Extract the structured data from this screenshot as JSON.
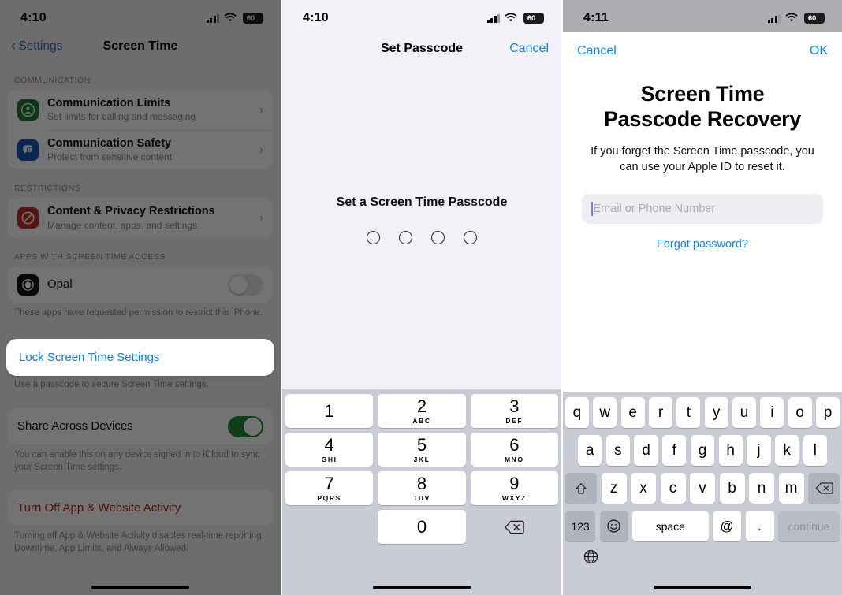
{
  "panel1": {
    "status": {
      "time": "4:10",
      "battery_pct": "60"
    },
    "nav": {
      "back_label": "Settings",
      "title": "Screen Time"
    },
    "groups": [
      {
        "header": "COMMUNICATION",
        "rows": [
          {
            "title": "Communication Limits",
            "subtitle": "Set limits for calling and messaging",
            "icon": "person-circle-icon",
            "accessory": "chevron-right-icon"
          },
          {
            "title": "Communication Safety",
            "subtitle": "Protect from sensitive content",
            "icon": "message-shield-icon",
            "accessory": "chevron-right-icon"
          }
        ]
      },
      {
        "header": "RESTRICTIONS",
        "rows": [
          {
            "title": "Content & Privacy Restrictions",
            "subtitle": "Manage content, apps, and settings",
            "icon": "no-entry-icon",
            "accessory": "chevron-right-icon"
          }
        ]
      },
      {
        "header": "APPS WITH SCREEN TIME ACCESS",
        "rows": [
          {
            "title": "Opal",
            "icon": "opal-app-icon",
            "accessory": "toggle-off"
          }
        ],
        "footnote": "These apps have requested permission to restrict this iPhone."
      }
    ],
    "lock_row": {
      "label": "Lock Screen Time Settings",
      "footnote": "Use a passcode to secure Screen Time settings."
    },
    "share_row": {
      "label": "Share Across Devices",
      "toggle": "on",
      "footnote": "You can enable this on any device signed in to iCloud to sync your Screen Time settings."
    },
    "turn_off_row": {
      "label": "Turn Off App & Website Activity",
      "footnote": "Turning off App & Website Activity disables real-time reporting, Downtime, App Limits, and Always Allowed."
    },
    "colors": {
      "accent": "#0a7bf4",
      "destructive": "#b32a24",
      "toggle_on": "#1d8a35"
    }
  },
  "panel2": {
    "status": {
      "time": "4:10",
      "battery_pct": "60"
    },
    "nav": {
      "title": "Set Passcode",
      "cancel_label": "Cancel"
    },
    "prompt": "Set a Screen Time Passcode",
    "dots_count": 4,
    "dots_filled": 0,
    "numpad": [
      [
        {
          "digit": "1",
          "letters": ""
        },
        {
          "digit": "2",
          "letters": "ABC"
        },
        {
          "digit": "3",
          "letters": "DEF"
        }
      ],
      [
        {
          "digit": "4",
          "letters": "GHI"
        },
        {
          "digit": "5",
          "letters": "JKL"
        },
        {
          "digit": "6",
          "letters": "MNO"
        }
      ],
      [
        {
          "digit": "7",
          "letters": "PQRS"
        },
        {
          "digit": "8",
          "letters": "TUV"
        },
        {
          "digit": "9",
          "letters": "WXYZ"
        }
      ],
      [
        {
          "digit": "",
          "letters": ""
        },
        {
          "digit": "0",
          "letters": ""
        },
        {
          "digit": "delete-icon",
          "letters": ""
        }
      ]
    ]
  },
  "panel3": {
    "status": {
      "time": "4:11",
      "battery_pct": "60"
    },
    "sheet_bar": {
      "cancel_label": "Cancel",
      "ok_label": "OK"
    },
    "title_line1": "Screen Time",
    "title_line2": "Passcode Recovery",
    "body": "If you forget the Screen Time passcode, you can use your Apple ID to reset it.",
    "field": {
      "placeholder": "Email or Phone Number",
      "value": ""
    },
    "forgot_label": "Forgot password?",
    "keyboard": {
      "row1": [
        "q",
        "w",
        "e",
        "r",
        "t",
        "y",
        "u",
        "i",
        "o",
        "p"
      ],
      "row2": [
        "a",
        "s",
        "d",
        "f",
        "g",
        "h",
        "j",
        "k",
        "l"
      ],
      "row3": [
        "z",
        "x",
        "c",
        "v",
        "b",
        "n",
        "m"
      ],
      "shift": "shift-icon",
      "backspace": "delete-icon",
      "numbers_label": "123",
      "emoji": "emoji-icon",
      "space_label": "space",
      "at_label": "@",
      "dot_label": ".",
      "go_label": "continue",
      "globe": "globe-icon"
    }
  }
}
